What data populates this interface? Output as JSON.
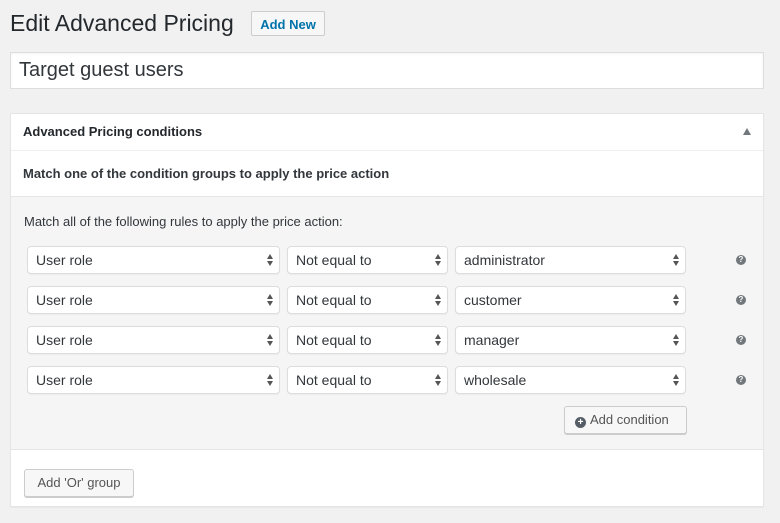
{
  "header": {
    "title": "Edit Advanced Pricing",
    "add_new_label": "Add New"
  },
  "title_input": {
    "value": "Target guest users"
  },
  "panel": {
    "title": "Advanced Pricing conditions",
    "toggle_icon": "triangle-up-icon",
    "subtitle": "Match one of the condition groups to apply the price action",
    "group": {
      "label": "Match all of the following rules to apply the price action:",
      "rules": [
        {
          "field": "User role",
          "operator": "Not equal to",
          "value": "administrator"
        },
        {
          "field": "User role",
          "operator": "Not equal to",
          "value": "customer"
        },
        {
          "field": "User role",
          "operator": "Not equal to",
          "value": "manager"
        },
        {
          "field": "User role",
          "operator": "Not equal to",
          "value": "wholesale"
        }
      ],
      "help_icon_glyph": "?",
      "add_condition_label": "Add condition",
      "add_condition_icon_glyph": "+"
    },
    "add_or_group_label": "Add 'Or' group"
  },
  "colors": {
    "link": "#0073aa",
    "page_bg": "#f1f1f1",
    "group_bg": "#f5f5f5"
  }
}
